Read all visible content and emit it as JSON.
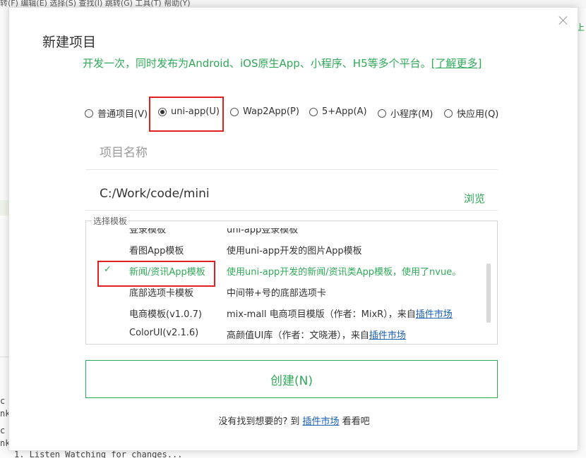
{
  "background": {
    "menubar_text": "转(F)  编辑(E)  选择(S)  查找(I)  跳转(G)  工具(T)  帮助(Y)",
    "right_glyph": "上",
    "code_lines": [
      "c",
      "nk",
      "c",
      "nk"
    ],
    "bottom_text": "1. Listen Watching for changes..."
  },
  "dialog": {
    "title": "新建项目",
    "subtitle": "开发一次，同时发布为Android、iOS原生App、小程序、H5等多个平台。",
    "subtitle_link": "[了解更多]",
    "project_types": [
      {
        "label": "普通项目(V)",
        "checked": false
      },
      {
        "label": "uni-app(U)",
        "checked": true
      },
      {
        "label": "Wap2App(P)",
        "checked": false
      },
      {
        "label": "5+App(A)",
        "checked": false
      },
      {
        "label": "小程序(M)",
        "checked": false
      },
      {
        "label": "快应用(Q)",
        "checked": false
      }
    ],
    "project_name_placeholder": "项目名称",
    "project_path": "C:/Work/code/mini",
    "browse_label": "浏览",
    "template_legend": "选择模板",
    "templates": [
      {
        "name": "登录模板",
        "desc": "uni-app登录模板",
        "link": "",
        "selected": false
      },
      {
        "name": "看图App模板",
        "desc": "使用uni-app开发的图片App模板",
        "link": "",
        "selected": false
      },
      {
        "name": "新闻/资讯App模板",
        "desc": "使用uni-app开发的新闻/资讯类App模板，使用了nvue。",
        "link": "",
        "selected": true
      },
      {
        "name": "底部选项卡模板",
        "desc": "中间带+号的底部选项卡",
        "link": "",
        "selected": false
      },
      {
        "name": "电商模板(v1.0.7)",
        "desc": "mix-mall 电商项目模版（作者：MixR），来自",
        "link": "插件市场",
        "selected": false
      },
      {
        "name": "ColorUI(v2.1.6)",
        "desc": "高颜值UI库（作者：文晓港），来自",
        "link": "插件市场",
        "selected": false
      }
    ],
    "check_glyph": "✓",
    "create_label": "创建(N)",
    "footer_prefix": "没有找到想要的? 到",
    "footer_link": "插件市场",
    "footer_suffix": "看看吧"
  },
  "colors": {
    "accent": "#2eaa57",
    "highlight": "#e02020",
    "link": "#1a5fb4"
  }
}
